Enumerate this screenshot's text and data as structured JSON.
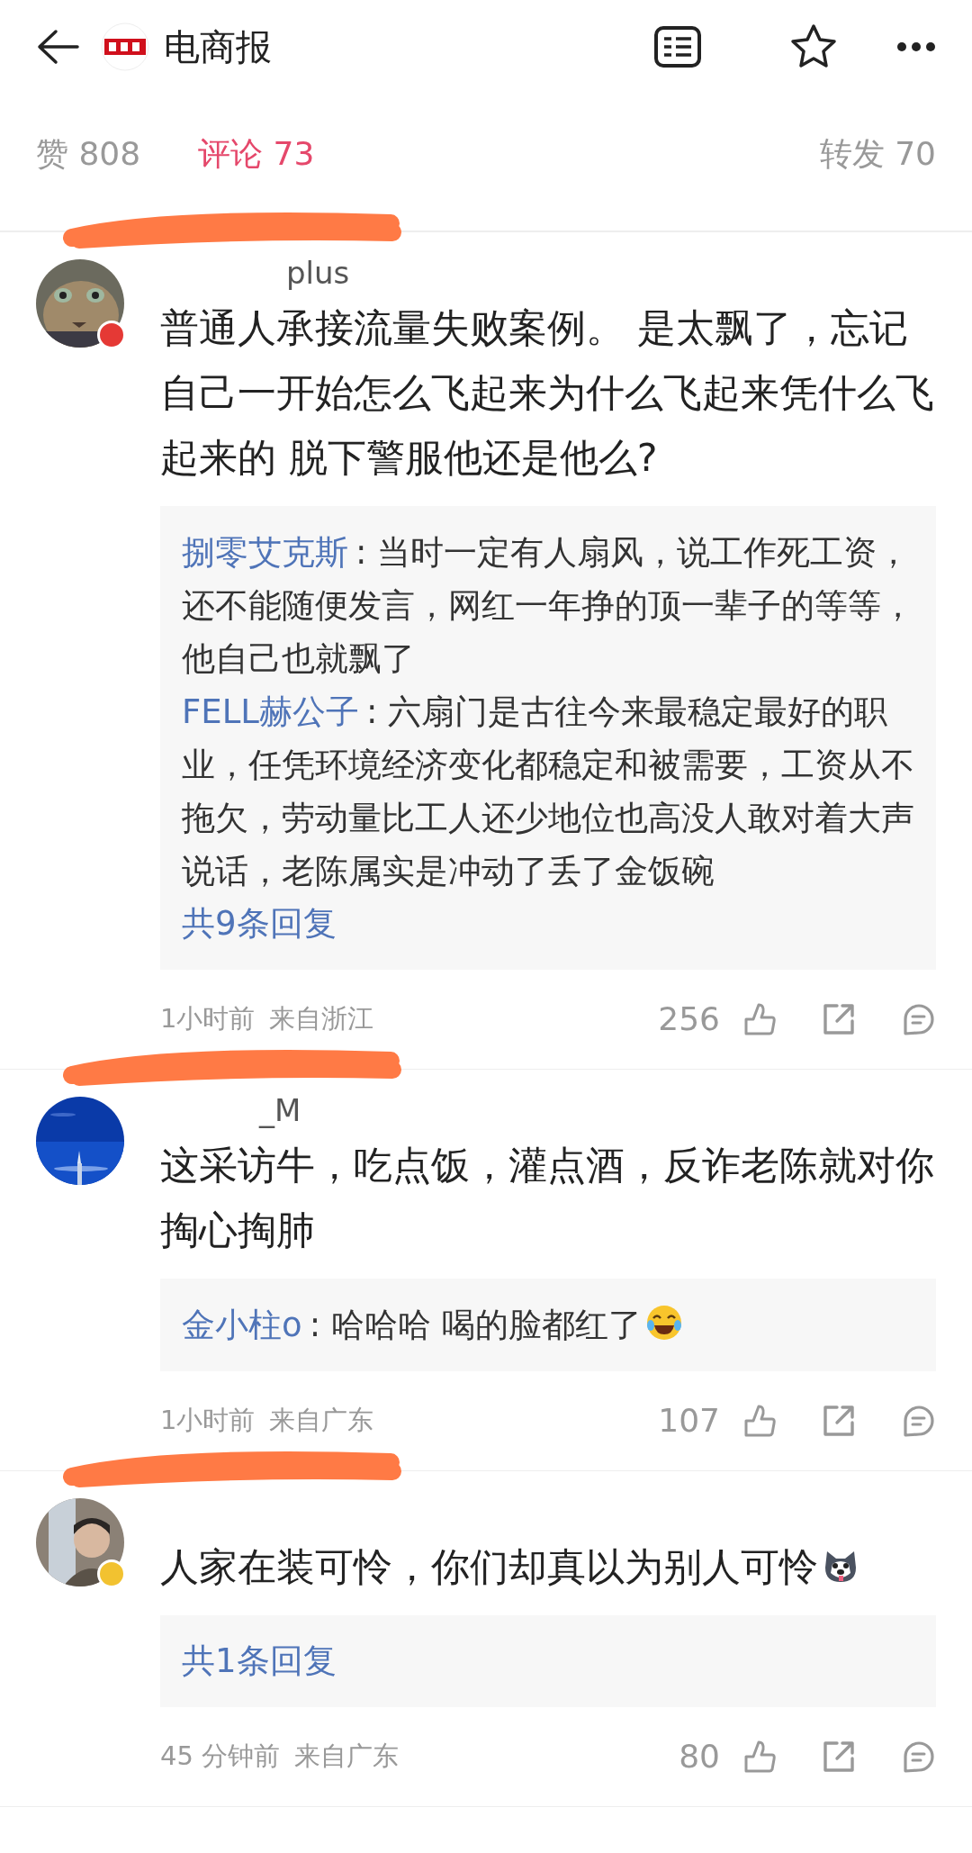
{
  "header": {
    "title": "电商报"
  },
  "tabs": [
    {
      "label": "赞 808",
      "selected": false
    },
    {
      "label": "评论 73",
      "selected": true
    },
    {
      "label": "转发 70",
      "selected": false
    }
  ],
  "comments": [
    {
      "name": "plus",
      "redacted": true,
      "badge": {
        "color": "#e53935"
      },
      "kind": "plain",
      "text": "普通人承接流量失败案例。 是太飘了，忘记自己一开始怎么飞起来为什么飞起来凭什么飞起来的 脱下警服他还是他么?",
      "replies": [
        {
          "user": "捌零艾克斯",
          "kind": "plain",
          "text": ": 当时一定有人扇风，说工作死工资，还不能随便发言，网红一年挣的顶一辈子的等等，他自己也就飘了"
        },
        {
          "user": "FELL赫公子",
          "kind": "plain",
          "text": ": 六扇门是古往今来最稳定最好的职业，任凭环境经济变化都稳定和被需要，工资从不拖欠，劳动量比工人还少地位也高没人敢对着大声说话，老陈属实是冲动了丢了金饭碗"
        }
      ],
      "more": "共9条回复",
      "time": "1小时前",
      "location": "来自浙江",
      "likes": "256"
    },
    {
      "name": "_M",
      "redacted": true,
      "kind": "plain",
      "text": "这采访牛，吃点饭，灌点酒，反诈老陈就对你掏心掏肺",
      "replies": [
        {
          "user": "金小柱o",
          "kind": "laugh",
          "text": ": 哈哈哈 喝的脸都红了"
        }
      ],
      "time": "1小时前",
      "location": "来自广东",
      "likes": "107"
    },
    {
      "redacted": true,
      "badge": {
        "color": "#f2c230"
      },
      "kind": "dog",
      "text": "人家在装可怜，你们却真以为别人可怜",
      "more": "共1条回复",
      "time": "45 分钟前",
      "location": "来自广东",
      "likes": "80"
    }
  ]
}
